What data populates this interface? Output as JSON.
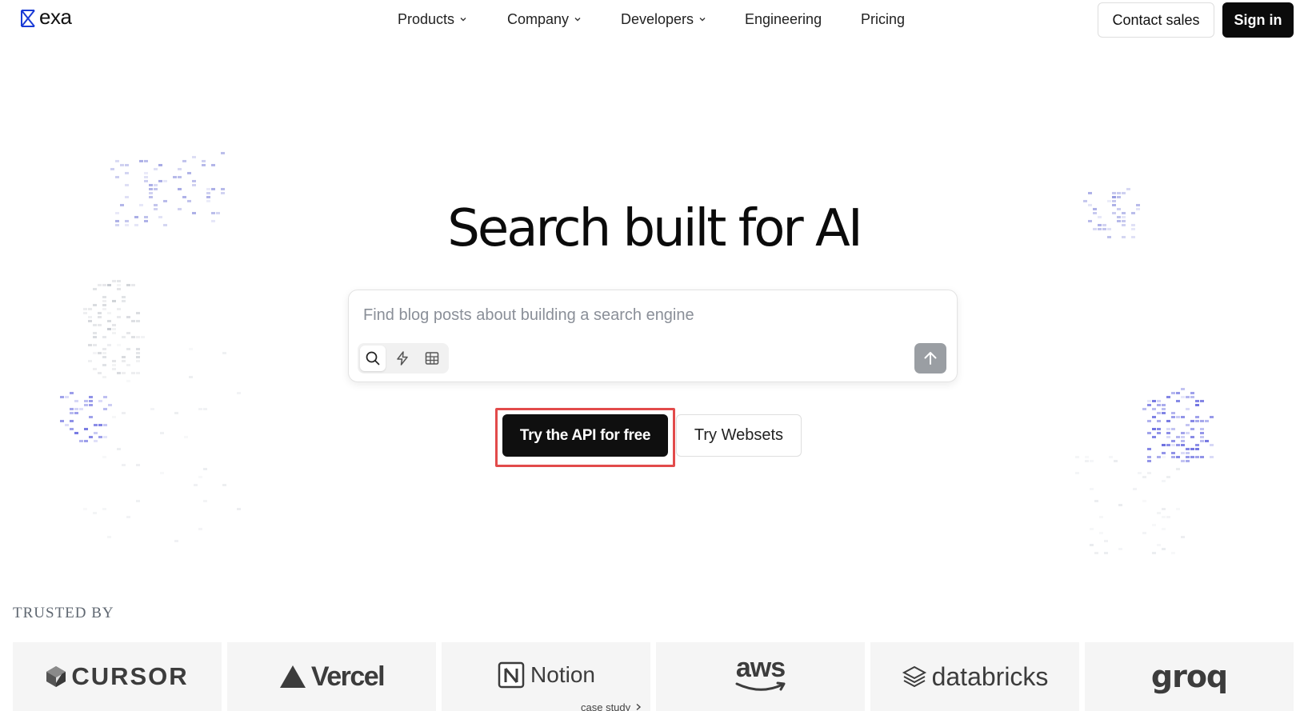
{
  "header": {
    "logo_text": "exa",
    "nav": [
      {
        "label": "Products",
        "has_dropdown": true
      },
      {
        "label": "Company",
        "has_dropdown": true
      },
      {
        "label": "Developers",
        "has_dropdown": true
      },
      {
        "label": "Engineering",
        "has_dropdown": false
      },
      {
        "label": "Pricing",
        "has_dropdown": false
      }
    ],
    "contact_sales": "Contact sales",
    "sign_in": "Sign in"
  },
  "hero": {
    "title": "Search built for AI",
    "search": {
      "placeholder": "Find blog posts about building a search engine",
      "value": "",
      "modes": [
        {
          "icon": "search-icon",
          "active": true
        },
        {
          "icon": "lightning-icon",
          "active": false
        },
        {
          "icon": "table-icon",
          "active": false
        }
      ],
      "submit_icon": "arrow-up-icon"
    },
    "cta_primary": "Try the API for free",
    "cta_secondary": "Try Websets"
  },
  "trusted": {
    "label": "TRUSTED BY",
    "logos": [
      {
        "name": "CURSOR",
        "icon": "cursor-cube-icon"
      },
      {
        "name": "Vercel",
        "icon": "vercel-triangle-icon"
      },
      {
        "name": "Notion",
        "icon": "notion-icon",
        "sub": "case study"
      },
      {
        "name": "aws",
        "icon": "aws-smile-icon"
      },
      {
        "name": "databricks",
        "icon": "databricks-stack-icon"
      },
      {
        "name": "groq",
        "icon": ""
      }
    ]
  },
  "colors": {
    "accent_blue": "#1a3bd6",
    "primary_button": "#0f0f0f",
    "highlight_border": "#e24b4b",
    "submit_disabled": "#9a9ea3",
    "decor_purple": "#6b6ee0"
  }
}
